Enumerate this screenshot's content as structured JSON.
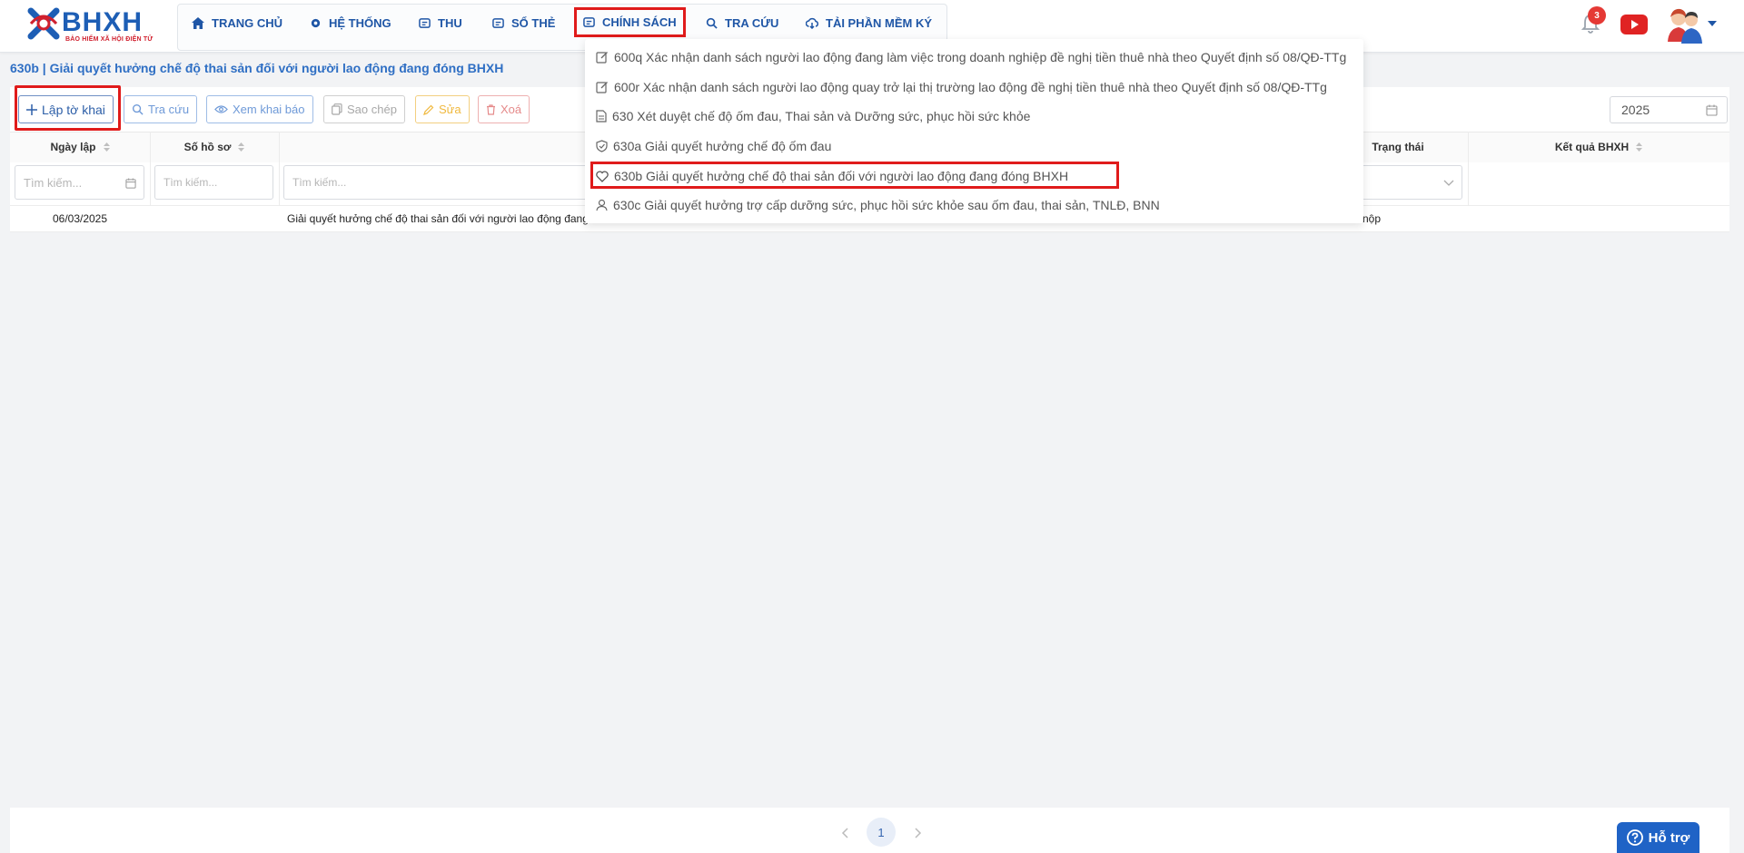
{
  "app": {
    "logo_text": "BHXH",
    "logo_subtitle": "BẢO HIỂM XÃ HỘI ĐIỆN TỬ",
    "notification_count": "3"
  },
  "nav": {
    "home": "TRANG CHỦ",
    "system": "HỆ THỐNG",
    "collect": "THU",
    "card": "SỔ THẺ",
    "policy": "CHÍNH SÁCH",
    "lookup": "TRA CỨU",
    "signing": "TẢI PHẦN MỀM KÝ"
  },
  "page": {
    "title": "630b | Giải quyết hưởng chế độ thai sản đối với người lao động đang đóng BHXH"
  },
  "toolbar": {
    "create": "Lập tờ khai",
    "search": "Tra cứu",
    "view": "Xem khai báo",
    "copy": "Sao chép",
    "edit": "Sửa",
    "delete": "Xoá",
    "year": "2025"
  },
  "table": {
    "headers": {
      "date": "Ngày lập",
      "file_no": "Số hồ sơ",
      "status": "Trạng thái",
      "result": "Kết quả BHXH"
    },
    "filters": {
      "date_placeholder": "Tìm kiếm...",
      "file_placeholder": "Tìm kiếm...",
      "name_placeholder": "Tìm kiếm..."
    },
    "rows": [
      {
        "date": "06/03/2025",
        "file_no": "",
        "name": "Giải quyết hưởng chế độ thai sản đối với người lao động đang",
        "status": "nộp",
        "result": ""
      }
    ]
  },
  "dropdown": {
    "items": [
      {
        "label": "600q Xác nhận danh sách người lao động đang làm việc trong doanh nghiệp đề nghị tiền thuê nhà theo Quyết định số 08/QĐ-TTg",
        "icon": "edit-icon"
      },
      {
        "label": "600r Xác nhận danh sách người lao động quay trở lại thị trường lao động đề nghị tiền thuê nhà theo Quyết định số 08/QĐ-TTg",
        "icon": "edit-icon"
      },
      {
        "label": "630 Xét duyệt chế độ ốm đau, Thai sản và Dưỡng sức, phục hồi sức khỏe",
        "icon": "document-icon"
      },
      {
        "label": "630a Giải quyết hưởng chế độ ốm đau",
        "icon": "shield-check-icon"
      },
      {
        "label": "630b Giải quyết hưởng chế độ thai sản đối với người lao động đang đóng BHXH",
        "icon": "heart-icon"
      },
      {
        "label": "630c Giải quyết hưởng trợ cấp dưỡng sức, phục hồi sức khỏe sau ốm đau, thai sản, TNLĐ, BNN",
        "icon": "user-icon"
      }
    ]
  },
  "pagination": {
    "current": "1"
  },
  "help": {
    "label": "Hỗ trợ"
  },
  "colors": {
    "primary": "#1f56a6",
    "highlight": "#e01b1b",
    "title": "#2f6fc4"
  }
}
